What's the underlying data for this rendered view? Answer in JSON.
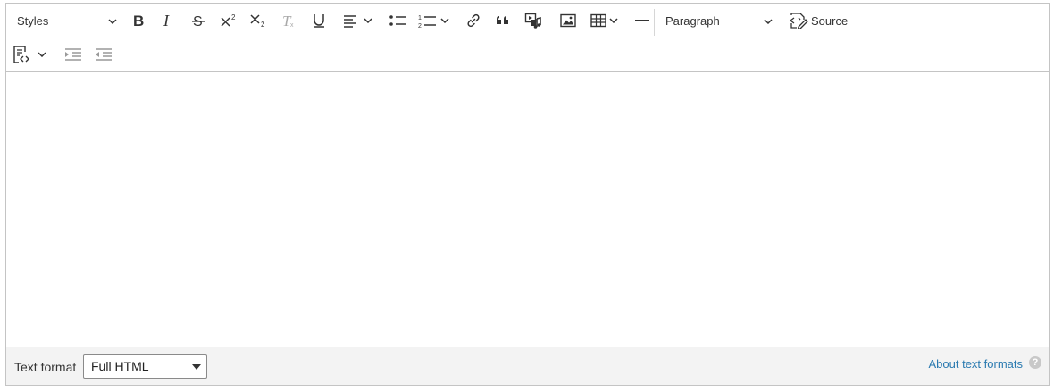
{
  "toolbar": {
    "styles_label": "Styles",
    "heading_label": "Paragraph",
    "source_label": "Source",
    "icons": {
      "bold": "bold-icon",
      "italic": "italic-icon",
      "strikethrough": "strikethrough-icon",
      "superscript": "superscript-icon",
      "subscript": "subscript-icon",
      "remove_format": "remove-format-icon",
      "underline": "underline-icon",
      "align": "text-align-icon",
      "bulleted_list": "bulleted-list-icon",
      "numbered_list": "numbered-list-icon",
      "link": "link-icon",
      "blockquote": "blockquote-icon",
      "media": "media-embed-icon",
      "image": "image-icon",
      "table": "table-icon",
      "horizontal_line": "horizontal-line-icon",
      "source": "source-icon",
      "code_block": "code-block-icon",
      "indent": "indent-icon",
      "outdent": "outdent-icon"
    }
  },
  "footer": {
    "text_format_label": "Text format",
    "text_format_value": "Full HTML",
    "about_link": "About text formats",
    "help_glyph": "?"
  }
}
